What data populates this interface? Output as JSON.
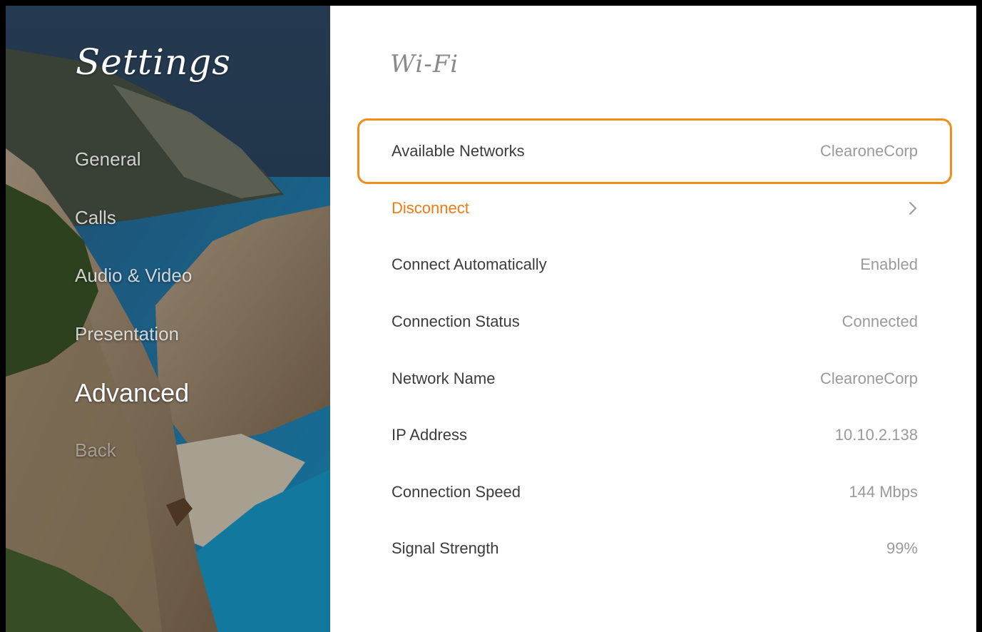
{
  "sidebar": {
    "title": "Settings",
    "items": [
      {
        "label": "General"
      },
      {
        "label": "Calls"
      },
      {
        "label": "Audio & Video"
      },
      {
        "label": "Presentation"
      },
      {
        "label": "Advanced"
      },
      {
        "label": "Back"
      }
    ],
    "active_item": "Advanced"
  },
  "main": {
    "title": "Wi-Fi",
    "rows": [
      {
        "label": "Available Networks",
        "value": "ClearoneCorp"
      },
      {
        "label": "Disconnect",
        "icon": "chevron-right-icon"
      },
      {
        "label": "Connect Automatically",
        "value": "Enabled"
      },
      {
        "label": "Connection Status",
        "value": "Connected"
      },
      {
        "label": "Network Name",
        "value": "ClearoneCorp"
      },
      {
        "label": "IP Address",
        "value": "10.10.2.138"
      },
      {
        "label": "Connection Speed",
        "value": "144 Mbps"
      },
      {
        "label": "Signal Strength",
        "value": "99%"
      }
    ]
  },
  "colors": {
    "accent": "#f28c1a",
    "action_text": "#f07a13",
    "label_text": "#3c3c3c",
    "value_text": "#9a9a9a",
    "title_text": "#8a8a8a"
  }
}
